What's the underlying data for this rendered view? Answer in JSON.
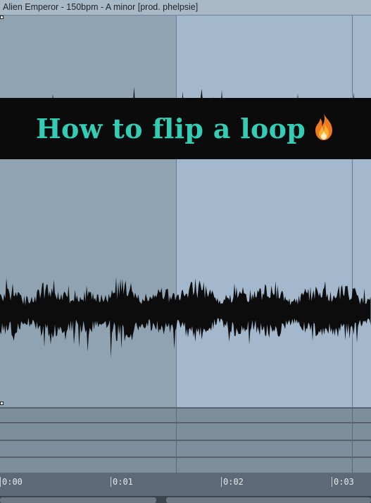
{
  "clip": {
    "title": "Alien Emperor - 150bpm - A minor [prod. phelpsie]"
  },
  "caption": {
    "text": "How to flip a loop",
    "emoji_icon": "fire-icon"
  },
  "timeline": {
    "labels": [
      "0:00",
      "0:01",
      "0:02",
      "0:03"
    ]
  },
  "colors": {
    "caption_text": "#33cdb6",
    "waveform": "#0c0c0c",
    "region_left": "#8fa3b3",
    "region_right": "#a3b8cc"
  }
}
